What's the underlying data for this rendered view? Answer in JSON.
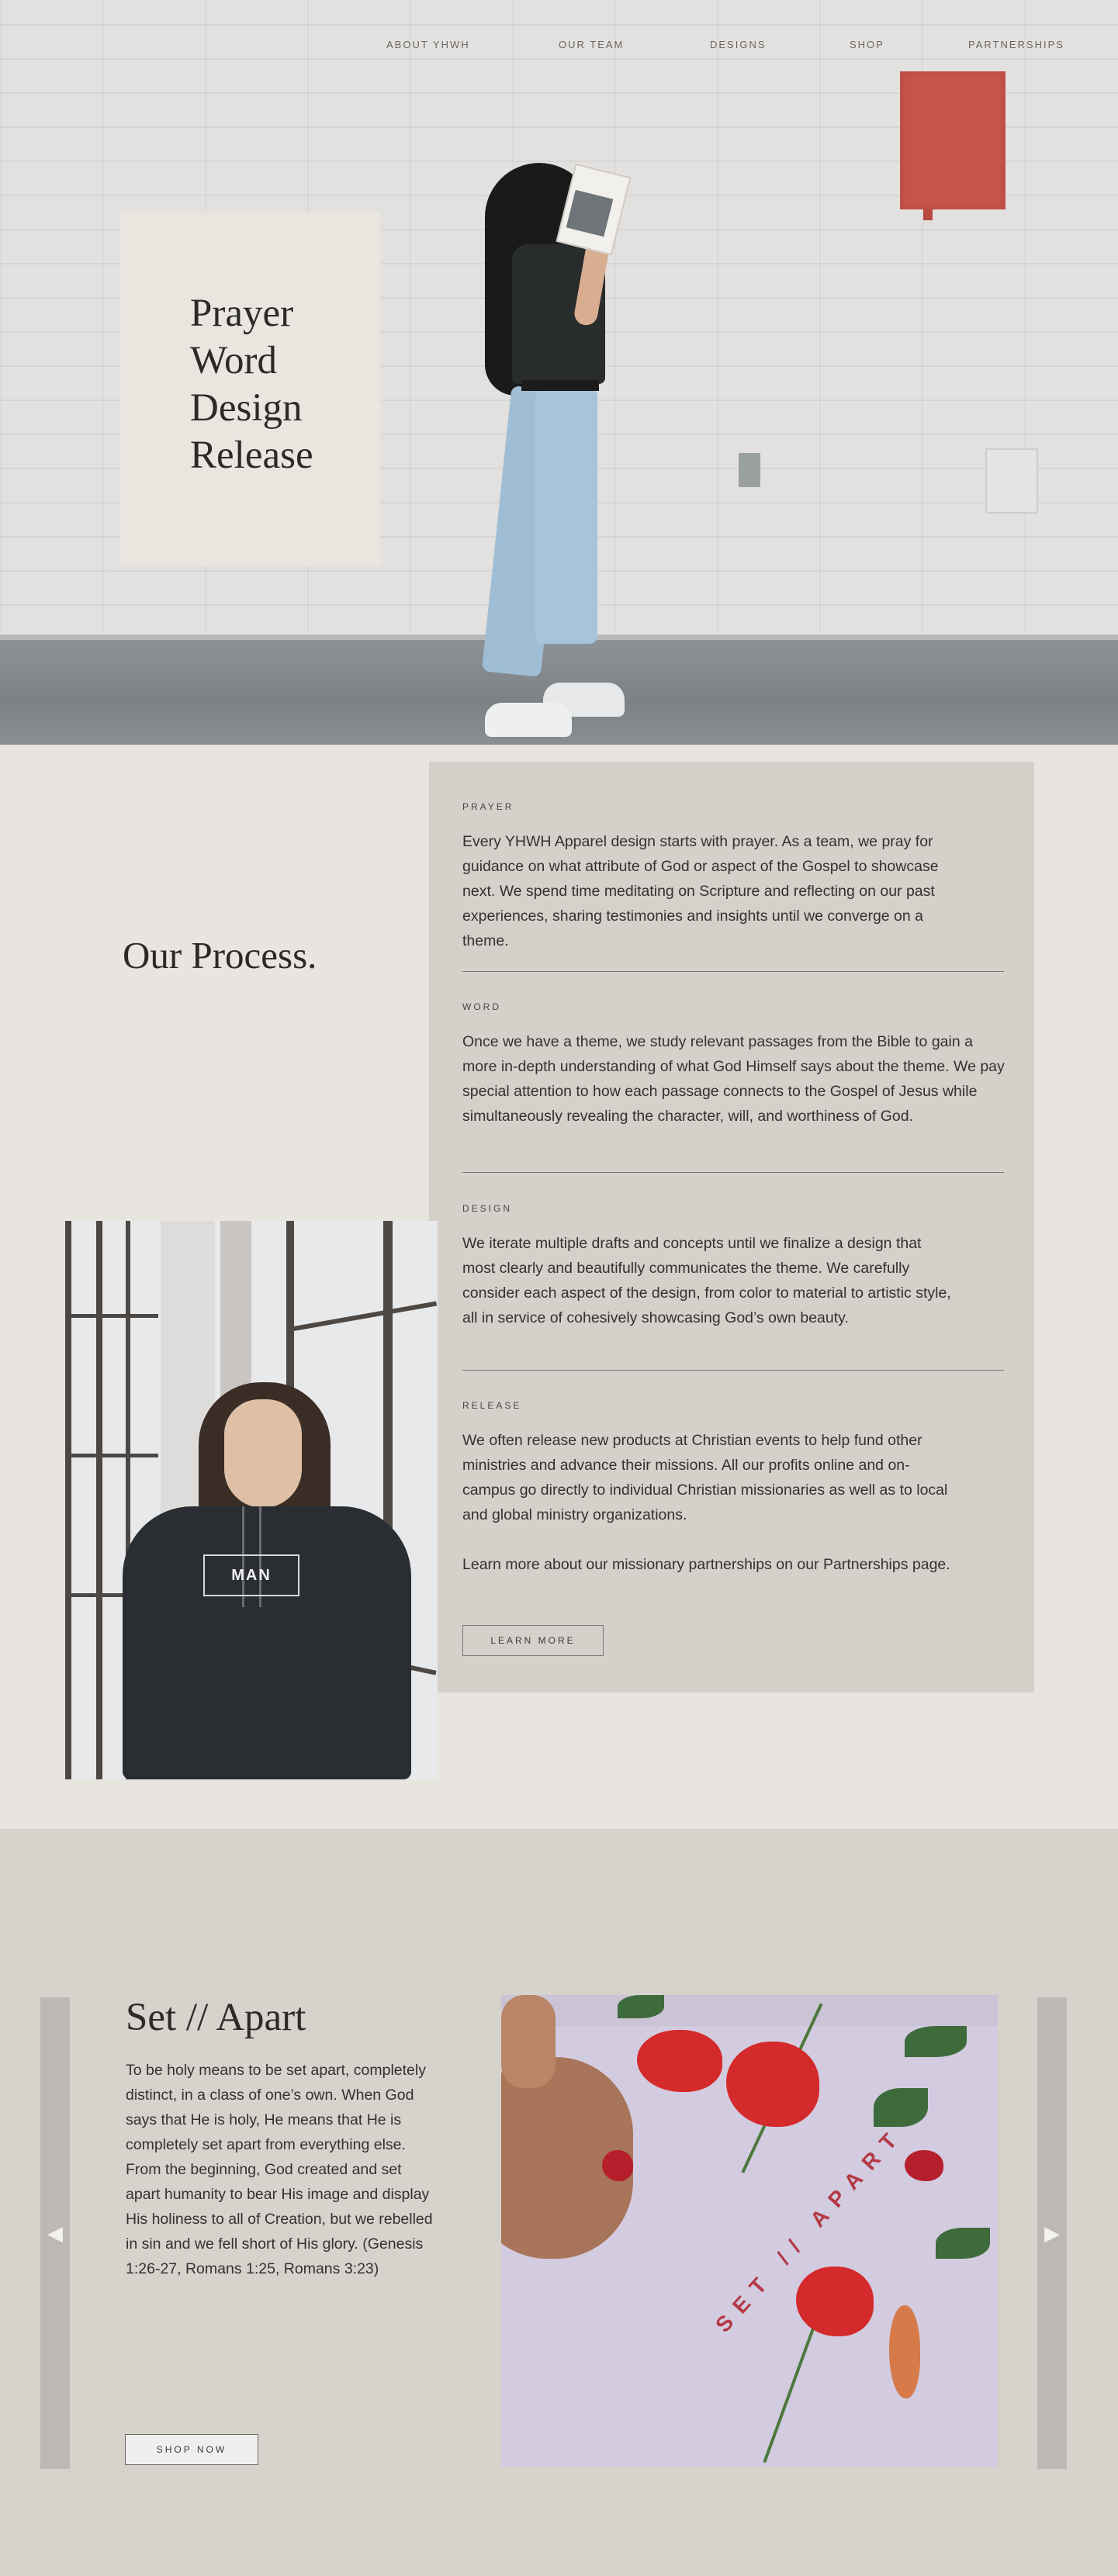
{
  "nav": {
    "items": [
      "ABOUT YHWH",
      "OUR TEAM",
      "DESIGNS",
      "SHOP",
      "PARTNERSHIPS"
    ]
  },
  "hero": {
    "title_lines": [
      "Prayer",
      "Word",
      "Design",
      "Release"
    ]
  },
  "process": {
    "heading": "Our Process.",
    "steps": [
      {
        "label": "PRAYER",
        "text": "Every YHWH Apparel design starts with prayer. As a team, we pray for guidance on what attribute of God or aspect of the Gospel to showcase next. We spend time meditating on Scripture and reflecting on our past experiences, sharing testimonies and insights until we converge on a theme."
      },
      {
        "label": "WORD",
        "text": "Once we have a theme, we study relevant passages from the Bible to gain a more in-depth understanding of what God Himself says about the theme. We pay special attention to how each passage connects to the Gospel of Jesus while simultaneously revealing the character, will, and worthiness of God."
      },
      {
        "label": "DESIGN",
        "text": "We iterate multiple drafts and concepts until we finalize a design that most clearly and beautifully communicates the theme. We carefully consider each aspect of the design, from color to material to artistic style, all in service of cohesively showcasing God’s own beauty."
      },
      {
        "label": "RELEASE",
        "text": "We often release new products at Christian events to help fund other ministries and advance their missions. All our profits online and on-campus go directly to individual Christian missionaries as well as to local and global ministry organizations.",
        "extra": "Learn more about our missionary partnerships on our Partnerships page."
      }
    ],
    "learn_more": "LEARN MORE",
    "hoodie_print": "MAN"
  },
  "set_apart": {
    "title": "Set // Apart",
    "body": "To be holy means to be set apart, completely distinct, in a class of one’s own. When God says that He is holy, He means that He is completely set apart from everything else. From the beginning, God created and set apart humanity to bear His image and display His holiness to all of Creation, but we rebelled in sin and we fell short of His glory. (Genesis 1:26-27, Romans 1:25, Romans 3:23)",
    "shop_now": "SHOP NOW",
    "shirt_print": "SET // APART",
    "prev_arrow": "◀",
    "next_arrow": "▶"
  },
  "colors": {
    "page_bg": "#e8e4df",
    "panel_bg": "#d5d0ca",
    "section_bg": "#d6d2cc",
    "accent_red": "#c7534a"
  }
}
